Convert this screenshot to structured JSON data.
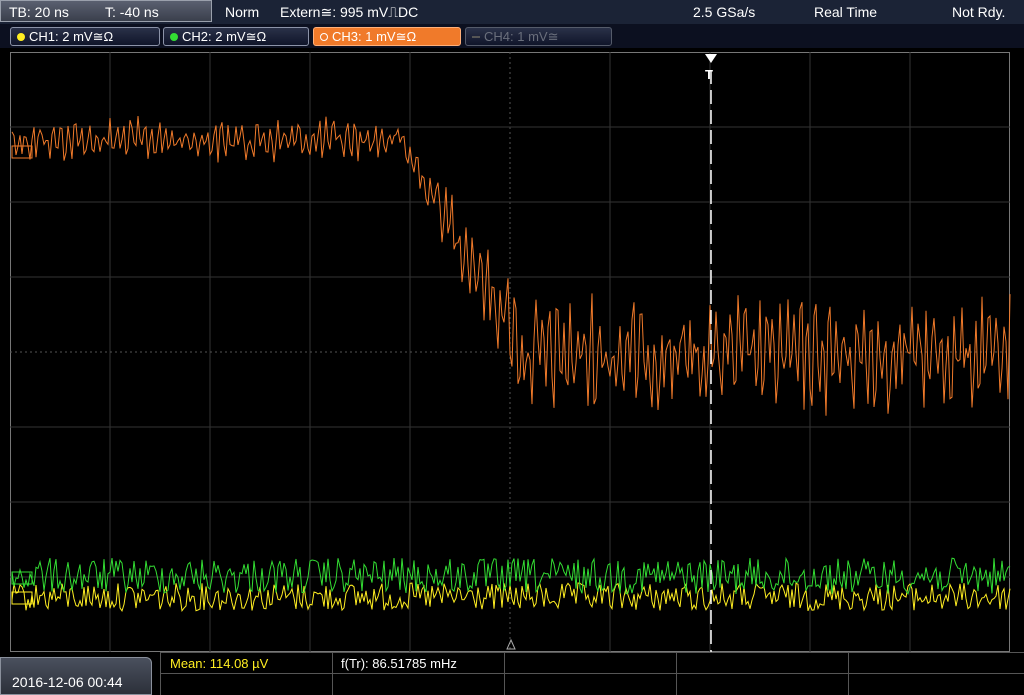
{
  "timebase": {
    "tb": "TB: 20 ns",
    "trigger_time": "T: -40 ns"
  },
  "status": {
    "mode": "Norm",
    "trigger_source": "Extern",
    "trigger_source_symbol": "≅:",
    "trigger_level": "995 mV",
    "trigger_coupling": "⎍DC",
    "sample_rate": "2.5 GSa/s",
    "acq_mode": "Real Time",
    "state": "Not Rdy."
  },
  "channels": [
    {
      "label": "CH1: 2 mV≅Ω",
      "color": "#ffee22",
      "state": "on"
    },
    {
      "label": "CH2: 2 mV≅Ω",
      "color": "#33dd33",
      "state": "on"
    },
    {
      "label": "CH3: 1 mV≅Ω",
      "color": "#f07a2a",
      "state": "active"
    },
    {
      "label": "CH4: 1 mV≅",
      "color": "#555555",
      "state": "off"
    }
  ],
  "trigger_marker": "T",
  "datetime": "2016-12-06 00:44",
  "measurements": {
    "mean": "Mean: 114.08 µV",
    "freq": "f(Tr): 86.51785 mHz"
  },
  "colors": {
    "ch1": "#ffee22",
    "ch2": "#33dd33",
    "ch3": "#f07a2a",
    "grid": "#3a3a3a",
    "frame": "#777777"
  }
}
